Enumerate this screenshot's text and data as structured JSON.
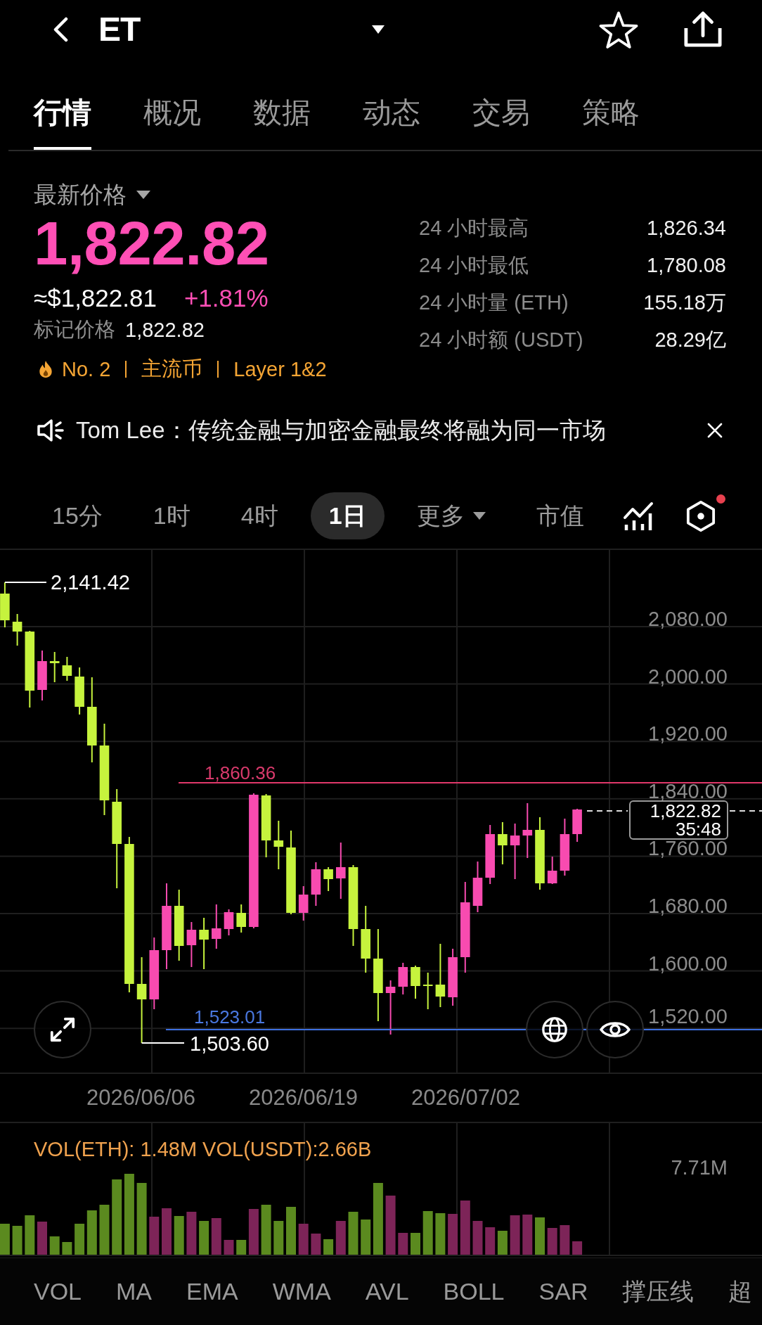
{
  "header": {
    "title": "ET"
  },
  "tabs": [
    {
      "label": "行情",
      "selected": true
    },
    {
      "label": "概况",
      "selected": false
    },
    {
      "label": "数据",
      "selected": false
    },
    {
      "label": "动态",
      "selected": false
    },
    {
      "label": "交易",
      "selected": false
    },
    {
      "label": "策略",
      "selected": false
    }
  ],
  "price": {
    "label": "最新价格",
    "last": "1,822.82",
    "usd": "≈$1,822.81",
    "change": "+1.81%",
    "mark_label": "标记价格",
    "mark_value": "1,822.82",
    "tags": [
      "No. 2",
      "主流币",
      "Layer 1&2"
    ]
  },
  "stats": [
    {
      "label": "24 小时最高",
      "value": "1,826.34"
    },
    {
      "label": "24 小时最低",
      "value": "1,780.08"
    },
    {
      "label": "24 小时量 (ETH)",
      "value": "155.18万"
    },
    {
      "label": "24 小时额 (USDT)",
      "value": "28.29亿"
    }
  ],
  "announcement": {
    "text": "Tom Lee：传统金融与加密金融最终将融为同一市场"
  },
  "intervals": [
    {
      "label": "15分",
      "kind": "option",
      "selected": false
    },
    {
      "label": "1时",
      "kind": "option",
      "selected": false
    },
    {
      "label": "4时",
      "kind": "option",
      "selected": false
    },
    {
      "label": "1日",
      "kind": "option",
      "selected": true
    },
    {
      "label": "更多",
      "kind": "menu",
      "selected": false
    },
    {
      "label": "市值",
      "kind": "option",
      "selected": false
    }
  ],
  "chart_tools": {
    "settings_badge": true
  },
  "price_chart": {
    "y_labels": [
      "2,080.00",
      "2,000.00",
      "1,920.00",
      "1,840.00",
      "1,760.00",
      "1,680.00",
      "1,600.00",
      "1,520.00"
    ],
    "high": "2,141.42",
    "low": "1,503.60",
    "resistance": "1,860.36",
    "support": "1,523.01",
    "last_price": "1,822.82",
    "countdown": "35:48",
    "dates": [
      "2026/06/06",
      "2026/06/19",
      "2026/07/02"
    ]
  },
  "volume": {
    "legend": "VOL(ETH): 1.48M VOL(USDT):2.66B",
    "max_label": "7.71M"
  },
  "indicators": [
    "VOL",
    "MA",
    "EMA",
    "WMA",
    "AVL",
    "BOLL",
    "SAR",
    "撑压线",
    "超"
  ]
}
